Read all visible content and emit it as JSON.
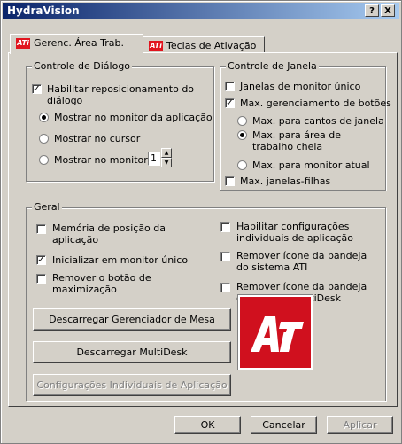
{
  "window": {
    "title": "HydraVision",
    "help": "?",
    "close": "X"
  },
  "tabs": [
    {
      "label": "Gerenc. Área Trab."
    },
    {
      "label": "Teclas de Ativação"
    }
  ],
  "dialog_control": {
    "legend": "Controle de Diálogo",
    "enable_reposition": {
      "label": "Habilitar reposicionamento do diálogo",
      "checked": true
    },
    "radios": [
      {
        "label": "Mostrar no monitor da aplicação",
        "selected": true
      },
      {
        "label": "Mostrar no cursor",
        "selected": false
      },
      {
        "label": "Mostrar no monitor",
        "selected": false
      }
    ],
    "monitor_value": "1"
  },
  "window_control": {
    "legend": "Controle de Janela",
    "single_monitor": {
      "label": "Janelas de monitor único",
      "checked": false
    },
    "max_buttons": {
      "label": "Max. gerenciamento de botões",
      "checked": true
    },
    "radios": [
      {
        "label": "Max. para cantos de janela",
        "selected": false
      },
      {
        "label": "Max. para área de trabalho cheia",
        "selected": true
      },
      {
        "label": "Max. para monitor atual",
        "selected": false
      }
    ],
    "max_child": {
      "label": "Max. janelas-filhas",
      "checked": false
    }
  },
  "general": {
    "legend": "Geral",
    "left": [
      {
        "label": "Memória de posição da aplicação",
        "checked": false
      },
      {
        "label": "Inicializar em monitor único",
        "checked": true
      },
      {
        "label": "Remover o botão de maximização",
        "checked": false
      }
    ],
    "right": [
      {
        "label": "Habilitar configurações individuais de aplicação",
        "checked": false
      },
      {
        "label": "Remover ícone da bandeja do sistema ATI",
        "checked": false
      },
      {
        "label": "Remover ícone da bandeja do sistema MultiDesk",
        "checked": false
      }
    ],
    "buttons": {
      "unload_manager": "Descarregar Gerenciador de Mesa",
      "unload_multidesk": "Descarregar MultiDesk",
      "individual_settings": "Configurações Individuais de Aplicação"
    },
    "logo_text": "ATi"
  },
  "footer": {
    "ok": "OK",
    "cancel": "Cancelar",
    "apply": "Aplicar"
  }
}
